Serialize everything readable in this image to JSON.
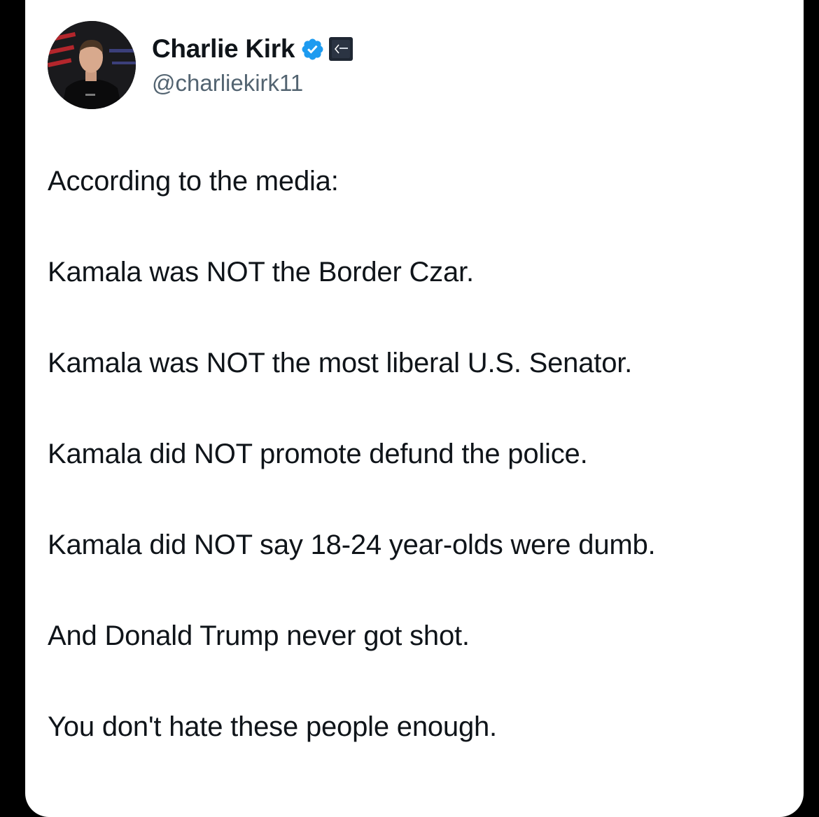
{
  "author": {
    "display_name": "Charlie Kirk",
    "handle": "@charliekirk11",
    "verified": true,
    "verified_icon": "verified-badge-icon",
    "affiliate_icon": "organization-affiliate-icon",
    "verified_color": "#1d9bf0"
  },
  "tweet": {
    "lines": [
      "According to the media:",
      "Kamala was NOT the Border Czar.",
      "Kamala was NOT the most liberal U.S. Senator.",
      "Kamala did NOT promote defund the police.",
      "Kamala did NOT say 18-24 year-olds were dumb.",
      "And Donald Trump never got shot.",
      "You don't hate these people enough."
    ]
  }
}
